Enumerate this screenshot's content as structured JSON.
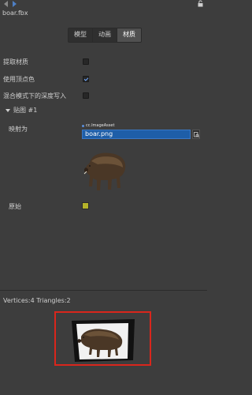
{
  "header": {
    "title": "boar.fbx",
    "back_icon": "arrow-left-icon",
    "forward_icon": "arrow-right-icon",
    "lock_icon": "lock-icon"
  },
  "tabs": [
    {
      "label": "模型",
      "active": false
    },
    {
      "label": "动画",
      "active": false
    },
    {
      "label": "材质",
      "active": true
    }
  ],
  "material": {
    "extract_label": "提取材质",
    "extract_checked": false,
    "vertex_color_label": "使用顶点色",
    "vertex_color_checked": true,
    "depth_write_label": "混合模式下的深度写入",
    "depth_write_checked": false
  },
  "texture_section": {
    "title": "贴图 #1",
    "map_label": "映射为",
    "asset_type": "cc.ImageAsset",
    "asset_value": "boar.png",
    "original_label": "原始",
    "original_color": "#b5b32a"
  },
  "stats": {
    "text": "Vertices:4   Triangles:2"
  },
  "colors": {
    "accent": "#1e5ea8",
    "highlight_border": "#d9261c"
  }
}
